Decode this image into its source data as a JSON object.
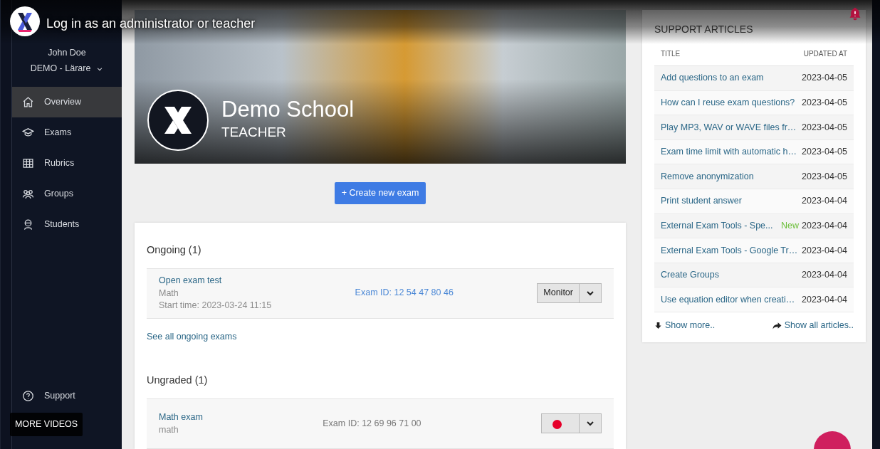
{
  "video_overlay": {
    "title": "Log in as an administrator or teacher",
    "more_videos": "MORE VIDEOS"
  },
  "sidebar": {
    "user_name": "John Doe",
    "role": "DEMO - Lärare",
    "items": [
      {
        "label": "Overview",
        "selected": true
      },
      {
        "label": "Exams",
        "selected": false
      },
      {
        "label": "Rubrics",
        "selected": false
      },
      {
        "label": "Groups",
        "selected": false
      },
      {
        "label": "Students",
        "selected": false
      }
    ],
    "footer_items": [
      {
        "label": "Support"
      }
    ]
  },
  "banner": {
    "school": "Demo School",
    "role": "TEACHER"
  },
  "create_button": "+ Create new exam",
  "sections": [
    {
      "heading": "Ongoing (1)",
      "exams": [
        {
          "title": "Open exam test",
          "subject": "Math",
          "start_time": "Start time: 2023-03-24 11:15",
          "exam_id": "Exam ID: 12 54 47 80 46",
          "action": "Monitor"
        }
      ],
      "link": "See all ongoing exams"
    },
    {
      "heading": "Ungraded (1)",
      "exams": [
        {
          "title": "Math exam",
          "subject": "math",
          "exam_id": "Exam ID: 12 69 96 71 00"
        }
      ]
    }
  ],
  "support_articles": {
    "title": "SUPPORT ARTICLES",
    "columns": [
      "TITLE",
      "UPDATED AT"
    ],
    "rows": [
      {
        "title": "Add questions to an exam",
        "updated": "2023-04-05"
      },
      {
        "title": "How can I reuse exam questions?",
        "updated": "2023-04-05"
      },
      {
        "title": "Play MP3, WAV or WAVE files fr…",
        "updated": "2023-04-05"
      },
      {
        "title": "Exam time limit with automatic h…",
        "updated": "2023-04-05"
      },
      {
        "title": "Remove anonymization",
        "updated": "2023-04-05"
      },
      {
        "title": "Print student answer",
        "updated": "2023-04-04"
      },
      {
        "title": "External Exam Tools - Spe...",
        "badge": "New",
        "updated": "2023-04-04"
      },
      {
        "title": "External Exam Tools - Google Tr…",
        "updated": "2023-04-04"
      },
      {
        "title": "Create Groups",
        "updated": "2023-04-04"
      },
      {
        "title": "Use equation editor when creati…",
        "updated": "2023-04-04"
      }
    ],
    "show_more": "Show more..",
    "show_all": "Show all articles.."
  }
}
